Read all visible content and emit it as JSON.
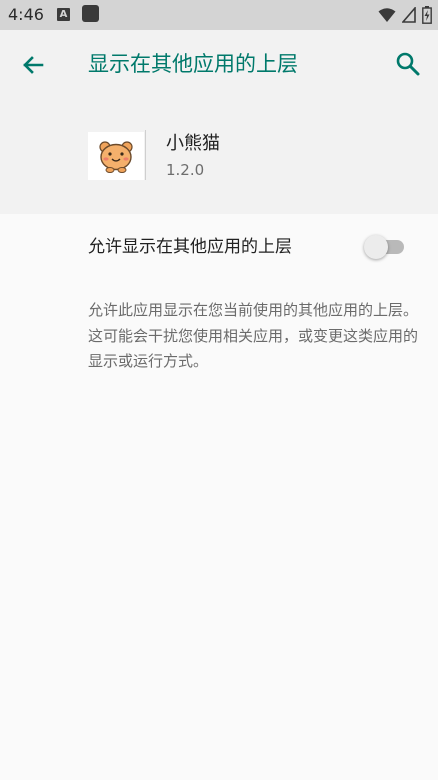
{
  "status_bar": {
    "time": "4:46",
    "notification_letter": "A"
  },
  "app_bar": {
    "title": "显示在其他应用的上层",
    "back_icon": "arrow-back-icon",
    "search_icon": "search-icon",
    "accent_color": "#00796b"
  },
  "app_info": {
    "name": "小熊猫",
    "version": "1.2.0",
    "icon": "cartoon-face-icon"
  },
  "setting": {
    "label": "允许显示在其他应用的上层",
    "enabled": false
  },
  "description": "允许此应用显示在您当前使用的其他应用的上层。这可能会干扰您使用相关应用，或变更这类应用的显示或运行方式。"
}
